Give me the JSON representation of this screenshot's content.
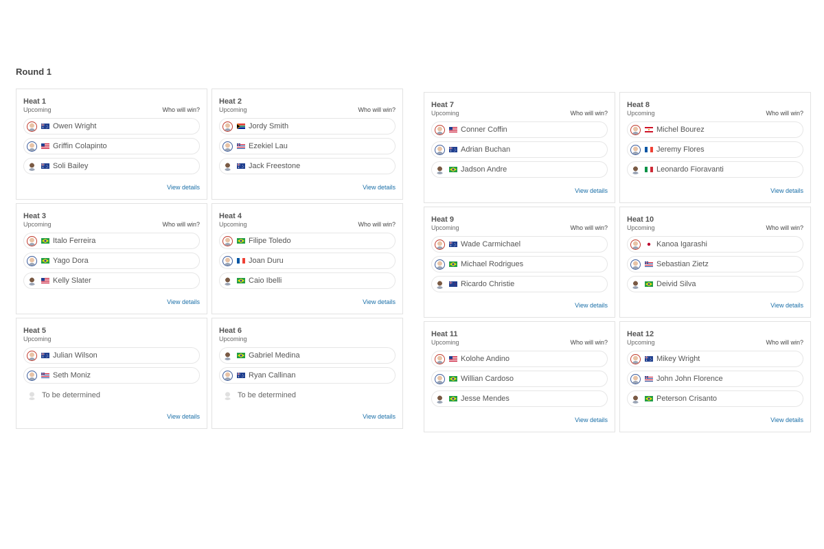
{
  "round": {
    "title": "Round 1"
  },
  "labels": {
    "who_will_win": "Who will win?",
    "view_details": "View details"
  },
  "heats": [
    {
      "name": "Heat 1",
      "status": "Upcoming",
      "show_who": true,
      "athletes": [
        {
          "name": "Owen Wright",
          "flag": "au",
          "avatar": "red"
        },
        {
          "name": "Griffin Colapinto",
          "flag": "us",
          "avatar": "blue"
        },
        {
          "name": "Soli Bailey",
          "flag": "au",
          "avatar": "plain"
        }
      ]
    },
    {
      "name": "Heat 2",
      "status": "Upcoming",
      "show_who": true,
      "athletes": [
        {
          "name": "Jordy Smith",
          "flag": "za",
          "avatar": "red"
        },
        {
          "name": "Ezekiel Lau",
          "flag": "hi",
          "avatar": "blue"
        },
        {
          "name": "Jack Freestone",
          "flag": "au",
          "avatar": "plain"
        }
      ]
    },
    {
      "name": "Heat 3",
      "status": "Upcoming",
      "show_who": true,
      "athletes": [
        {
          "name": "Italo Ferreira",
          "flag": "br",
          "avatar": "red"
        },
        {
          "name": "Yago Dora",
          "flag": "br",
          "avatar": "blue"
        },
        {
          "name": "Kelly Slater",
          "flag": "us",
          "avatar": "plain"
        }
      ]
    },
    {
      "name": "Heat 4",
      "status": "Upcoming",
      "show_who": true,
      "athletes": [
        {
          "name": "Filipe Toledo",
          "flag": "br",
          "avatar": "red"
        },
        {
          "name": "Joan Duru",
          "flag": "fr",
          "avatar": "blue"
        },
        {
          "name": "Caio Ibelli",
          "flag": "br",
          "avatar": "plain"
        }
      ]
    },
    {
      "name": "Heat 5",
      "status": "Upcoming",
      "show_who": false,
      "athletes": [
        {
          "name": "Julian Wilson",
          "flag": "au",
          "avatar": "red"
        },
        {
          "name": "Seth Moniz",
          "flag": "hi",
          "avatar": "blue"
        },
        {
          "name": "To be determined",
          "flag": "",
          "avatar": "ghost"
        }
      ]
    },
    {
      "name": "Heat 6",
      "status": "Upcoming",
      "show_who": false,
      "athletes": [
        {
          "name": "Gabriel Medina",
          "flag": "br",
          "avatar": "plain"
        },
        {
          "name": "Ryan Callinan",
          "flag": "au",
          "avatar": "blue"
        },
        {
          "name": "To be determined",
          "flag": "",
          "avatar": "ghost"
        }
      ]
    },
    {
      "name": "Heat 7",
      "status": "Upcoming",
      "show_who": true,
      "athletes": [
        {
          "name": "Conner Coffin",
          "flag": "us",
          "avatar": "red"
        },
        {
          "name": "Adrian Buchan",
          "flag": "au",
          "avatar": "blue"
        },
        {
          "name": "Jadson Andre",
          "flag": "br",
          "avatar": "plain"
        }
      ]
    },
    {
      "name": "Heat 8",
      "status": "Upcoming",
      "show_who": true,
      "athletes": [
        {
          "name": "Michel Bourez",
          "flag": "pf",
          "avatar": "red"
        },
        {
          "name": "Jeremy Flores",
          "flag": "fr",
          "avatar": "blue"
        },
        {
          "name": "Leonardo Fioravanti",
          "flag": "it",
          "avatar": "plain"
        }
      ]
    },
    {
      "name": "Heat 9",
      "status": "Upcoming",
      "show_who": true,
      "athletes": [
        {
          "name": "Wade Carmichael",
          "flag": "au",
          "avatar": "red"
        },
        {
          "name": "Michael Rodrigues",
          "flag": "br",
          "avatar": "blue"
        },
        {
          "name": "Ricardo Christie",
          "flag": "nz",
          "avatar": "plain"
        }
      ]
    },
    {
      "name": "Heat 10",
      "status": "Upcoming",
      "show_who": true,
      "athletes": [
        {
          "name": "Kanoa Igarashi",
          "flag": "jp",
          "avatar": "red"
        },
        {
          "name": "Sebastian Zietz",
          "flag": "hi",
          "avatar": "blue"
        },
        {
          "name": "Deivid Silva",
          "flag": "br",
          "avatar": "plain"
        }
      ]
    },
    {
      "name": "Heat 11",
      "status": "Upcoming",
      "show_who": true,
      "athletes": [
        {
          "name": "Kolohe Andino",
          "flag": "us",
          "avatar": "red"
        },
        {
          "name": "Willian Cardoso",
          "flag": "br",
          "avatar": "blue"
        },
        {
          "name": "Jesse Mendes",
          "flag": "br",
          "avatar": "plain"
        }
      ]
    },
    {
      "name": "Heat 12",
      "status": "Upcoming",
      "show_who": true,
      "athletes": [
        {
          "name": "Mikey Wright",
          "flag": "au",
          "avatar": "red"
        },
        {
          "name": "John John Florence",
          "flag": "hi",
          "avatar": "blue"
        },
        {
          "name": "Peterson Crisanto",
          "flag": "br",
          "avatar": "plain"
        }
      ]
    }
  ]
}
